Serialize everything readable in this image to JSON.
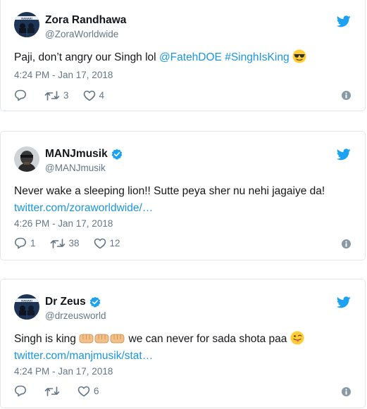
{
  "colors": {
    "link": "#1b95e0",
    "secondary_text": "#657786",
    "border": "#e1e8ed",
    "verified": "#1da1f2"
  },
  "tweets": [
    {
      "name": "Zora Randhawa",
      "handle": "@ZoraWorldwide",
      "verified": false,
      "text_plain": "Paji, don’t angry our Singh lol ",
      "mention": "@FatehDOE",
      "hashtag": "#SinghIsKing",
      "emoji": "smiling-face-with-sunglasses",
      "time": "4:24 PM - Jan 17, 2018",
      "replies": "",
      "retweets": "3",
      "likes": "4"
    },
    {
      "name": "MANJmusik",
      "handle": "@MANJmusik",
      "verified": true,
      "text_plain": "Never wake a sleeping lion!! Sutte peya sher nu nehi jagaiye da!",
      "link": "twitter.com/zoraworldwide/…",
      "time": "4:26 PM - Jan 17, 2018",
      "replies": "1",
      "retweets": "38",
      "likes": "12"
    },
    {
      "name": "Dr Zeus",
      "handle": "@drzeusworld",
      "verified": true,
      "text_before": "Singh is king",
      "emoji_fists": "oncoming-fist-x3",
      "text_after": "we can never for sada shota paa",
      "emoji_end": "winking-face-with-tongue",
      "link": "twitter.com/manjmusik/stat…",
      "time": "4:24 PM - Jan 17, 2018",
      "replies": "",
      "retweets": "",
      "likes": "6"
    }
  ]
}
